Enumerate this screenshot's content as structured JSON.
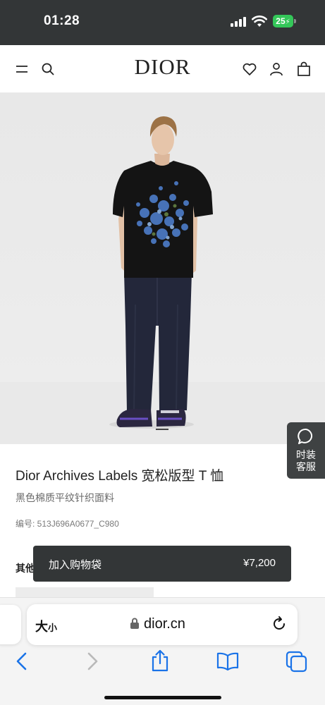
{
  "status_bar": {
    "time": "01:28",
    "battery": "25"
  },
  "header": {
    "logo": "DIOR",
    "icons": [
      "menu-icon",
      "search-icon",
      "heart-icon",
      "account-icon",
      "shopping-bag-icon"
    ]
  },
  "hero": {
    "image": "model wearing black floral T-shirt and dark jeans"
  },
  "chat": {
    "label": "时装客服"
  },
  "product": {
    "title": "Dior Archives Labels 宽松版型 T 恤",
    "subtitle": "黑色棉质平纹针织面料",
    "sku": "编号: 513J696A0677_C980",
    "other_label": "其他"
  },
  "add_to_bag": {
    "label": "加入购物袋",
    "price": "¥7,200"
  },
  "browser": {
    "text_size": "大",
    "text_size_small": "小",
    "url": "dior.cn"
  },
  "colors": {
    "dark": "#333637",
    "battery": "#34c759"
  }
}
